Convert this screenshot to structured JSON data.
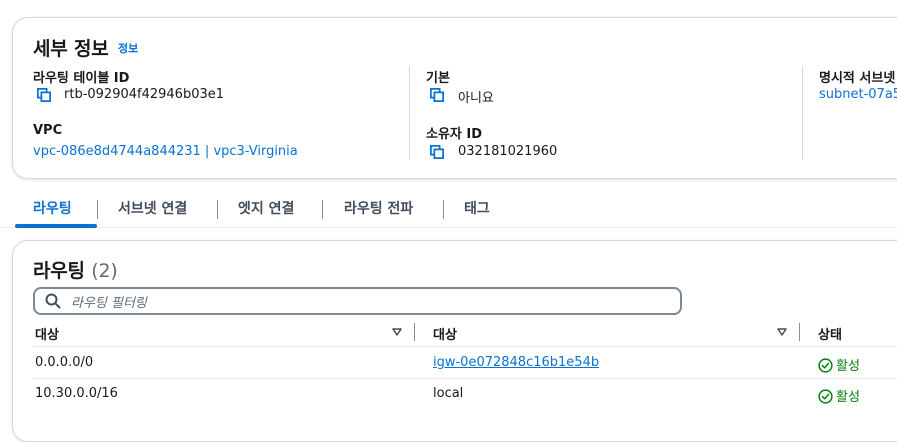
{
  "details": {
    "title": "세부 정보",
    "info": "정보",
    "route_table_id": {
      "label": "라우팅 테이블 ID",
      "value": "rtb-092904f42946b03e1"
    },
    "vpc": {
      "label": "VPC",
      "value": "vpc-086e8d4744a844231 | vpc3-Virginia"
    },
    "main": {
      "label": "기본",
      "value": "아니요"
    },
    "owner_id": {
      "label": "소유자 ID",
      "value": "032181021960"
    },
    "explicit_subnets": {
      "label": "명시적 서브넷",
      "value": "subnet-07a5"
    }
  },
  "tabs": [
    {
      "label": "라우팅",
      "active": true
    },
    {
      "label": "서브넷 연결"
    },
    {
      "label": "엣지 연결"
    },
    {
      "label": "라우팅 전파"
    },
    {
      "label": "태그"
    }
  ],
  "routes": {
    "title": "라우팅",
    "count": "(2)",
    "search_placeholder": "라우팅 필터링",
    "columns": [
      "대상",
      "대상",
      "상태"
    ],
    "rows": [
      {
        "destination": "0.0.0.0/0",
        "target": "igw-0e072848c16b1e54b",
        "target_is_link": true,
        "status": "활성"
      },
      {
        "destination": "10.30.0.0/16",
        "target": "local",
        "target_is_link": false,
        "status": "활성"
      }
    ]
  },
  "colors": {
    "link": "#0972d3",
    "success": "#037f0c",
    "text": "#16191f"
  },
  "icons": {
    "copy": "copy-icon",
    "search": "search-icon",
    "sort": "sort-down-icon",
    "status": "check-circle-icon"
  }
}
